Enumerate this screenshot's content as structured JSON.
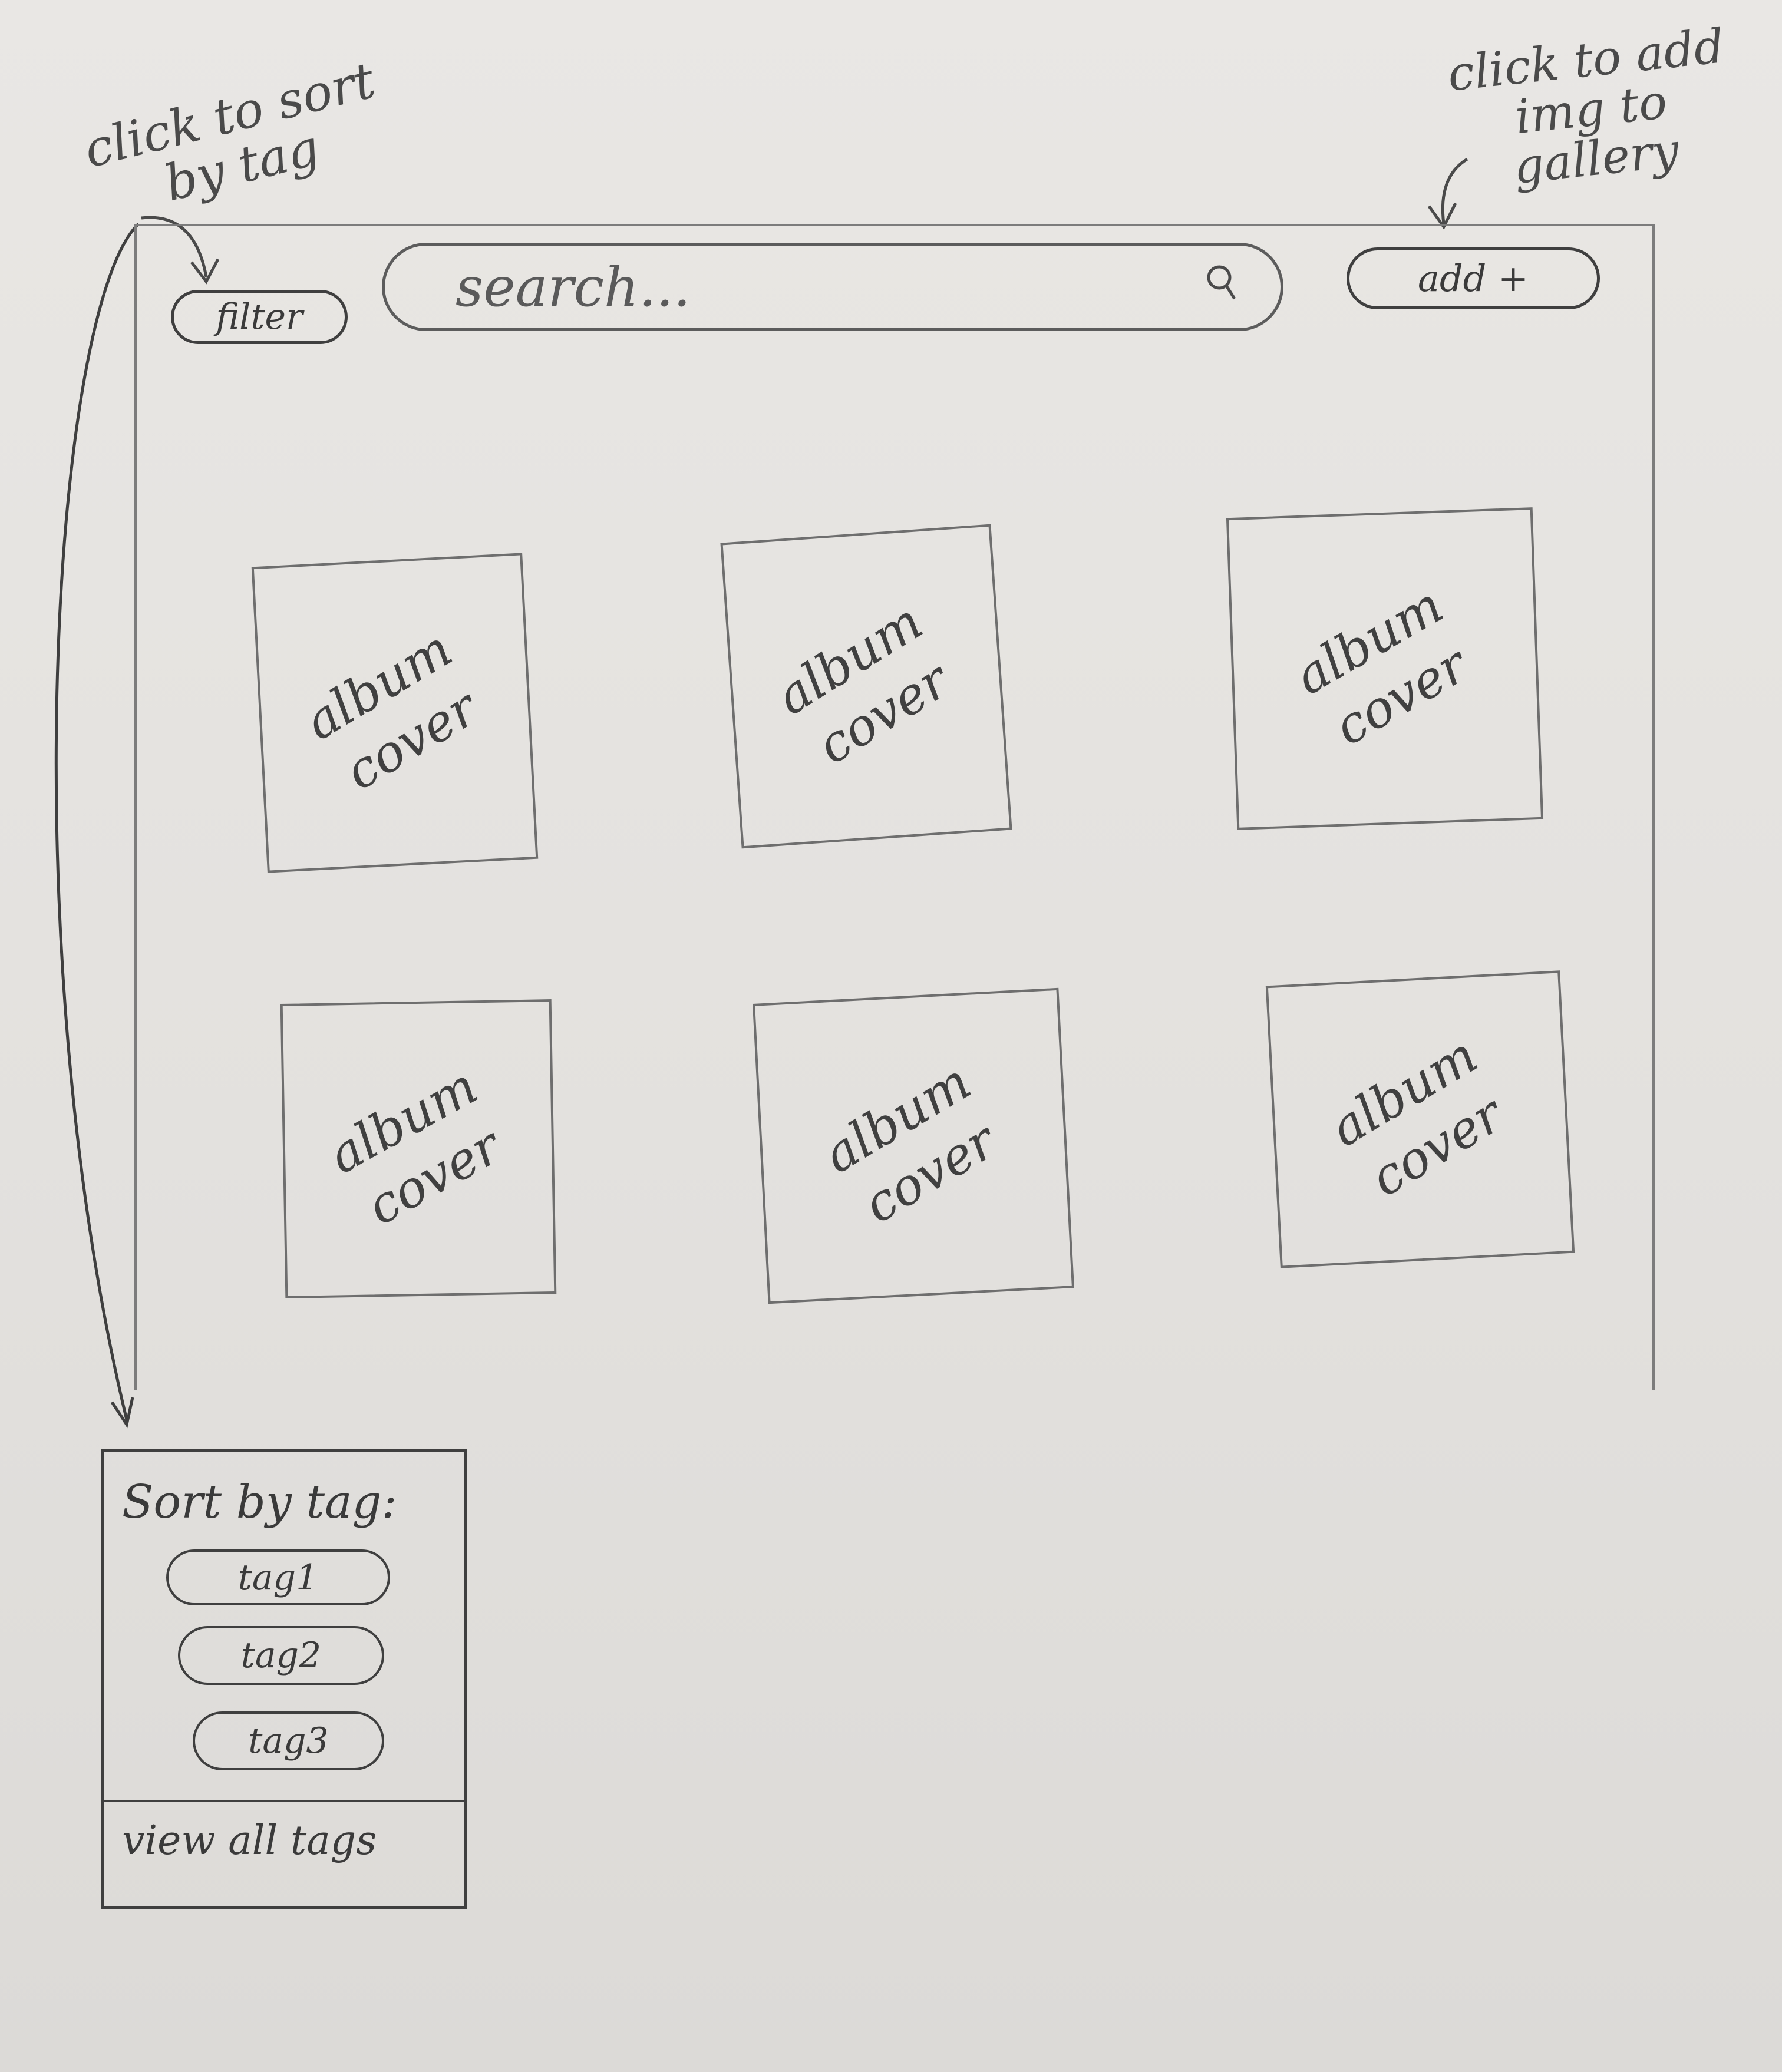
{
  "annotations": {
    "filter_note": "click to sort by tag",
    "add_note": "click to add img to gallery"
  },
  "toolbar": {
    "filter_label": "filter",
    "search_placeholder": "search...",
    "add_label": "add +"
  },
  "gallery": {
    "items": [
      {
        "label": "album\ncover"
      },
      {
        "label": "album\ncover"
      },
      {
        "label": "album\ncover"
      },
      {
        "label": "album\ncover"
      },
      {
        "label": "album\ncover"
      },
      {
        "label": "album\ncover"
      }
    ]
  },
  "tag_menu": {
    "title": "Sort by tag:",
    "tags": [
      {
        "label": "tag1"
      },
      {
        "label": "tag2"
      },
      {
        "label": "tag3"
      }
    ],
    "view_all_label": "view all tags"
  },
  "icons": {
    "search": "search-icon"
  },
  "colors": {
    "paper": "#e4e2e0",
    "pencil": "#3f3f3f"
  }
}
